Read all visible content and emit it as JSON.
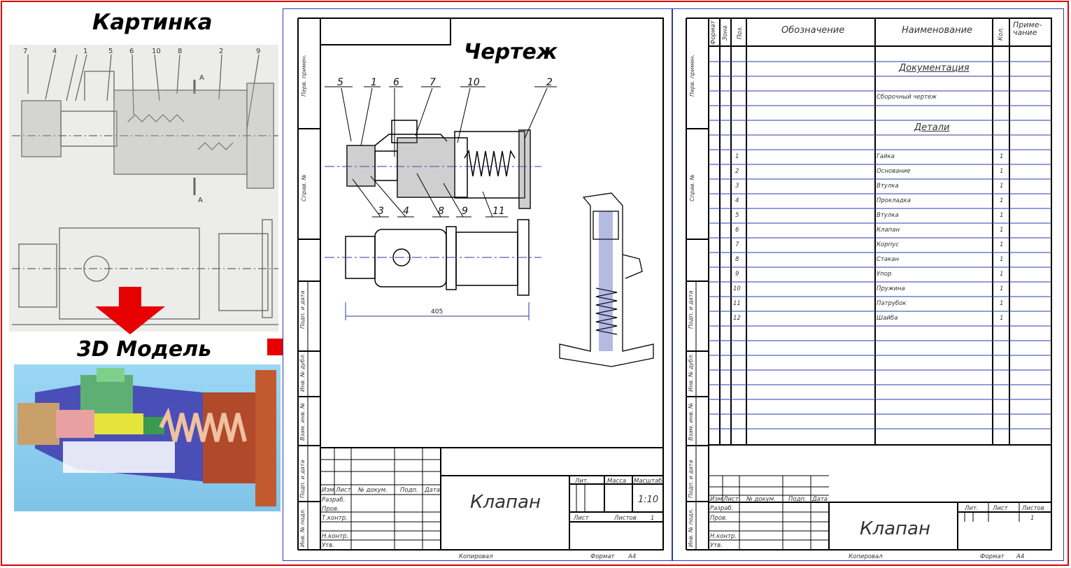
{
  "labels": {
    "kartinka": "Картинка",
    "model3d": "3D Модель",
    "chertezh": "Чертеж"
  },
  "photo_callouts": [
    "7",
    "4",
    "1",
    "5",
    "6",
    "10",
    "8",
    "2",
    "9"
  ],
  "photo_section_mark": "A",
  "drawing": {
    "callouts_top": [
      "5",
      "1",
      "6",
      "7",
      "10",
      "2"
    ],
    "callouts_bottom": [
      "3",
      "4",
      "8",
      "9",
      "11"
    ],
    "dimension": "405"
  },
  "title_block": {
    "headers": [
      "Изм",
      "Лист",
      "№ докум.",
      "Подп.",
      "Дата"
    ],
    "roles": [
      "Разраб.",
      "Пров.",
      "Т.контр.",
      "Н.контр.",
      "Утв."
    ],
    "name": "Клапан",
    "lit": "Лит.",
    "massa": "Масса",
    "masshtab": "Масштаб",
    "scale": "1:10",
    "list": "Лист",
    "listov": "Листов",
    "listov_val": "1",
    "kopiroval": "Копировал",
    "format": "Формат",
    "format_val": "A4"
  },
  "side_labels": [
    "Перв. примен.",
    "Справ. №",
    "Подп. и дата",
    "Инв. № дубл.",
    "Взам. инв. №",
    "Подп. и дата",
    "Инв. № подл."
  ],
  "spec": {
    "headers": {
      "format": "Формат",
      "zona": "Зона",
      "poz": "Поз.",
      "oboz": "Обозначение",
      "naim": "Наименование",
      "kol": "Кол.",
      "prim": "Приме-чание"
    },
    "section_docs": "Документация",
    "doc_item": "Сборочный чертеж",
    "section_parts": "Детали",
    "items": [
      {
        "poz": "1",
        "name": "Гайка",
        "qty": "1"
      },
      {
        "poz": "2",
        "name": "Основание",
        "qty": "1"
      },
      {
        "poz": "3",
        "name": "Втулка",
        "qty": "1"
      },
      {
        "poz": "4",
        "name": "Прокладка",
        "qty": "1"
      },
      {
        "poz": "5",
        "name": "Втулка",
        "qty": "1"
      },
      {
        "poz": "6",
        "name": "Клапан",
        "qty": "1"
      },
      {
        "poz": "7",
        "name": "Корпус",
        "qty": "1"
      },
      {
        "poz": "8",
        "name": "Стакан",
        "qty": "1"
      },
      {
        "poz": "9",
        "name": "Упор",
        "qty": "1"
      },
      {
        "poz": "10",
        "name": "Пружина",
        "qty": "1"
      },
      {
        "poz": "11",
        "name": "Патрубок",
        "qty": "1"
      },
      {
        "poz": "12",
        "name": "Шайба",
        "qty": "1"
      }
    ]
  },
  "colors": {
    "frame": "#e00000",
    "arrow": "#e60000",
    "sheet_line": "#2a3aa8",
    "model_bg": "#8fd0f0"
  }
}
